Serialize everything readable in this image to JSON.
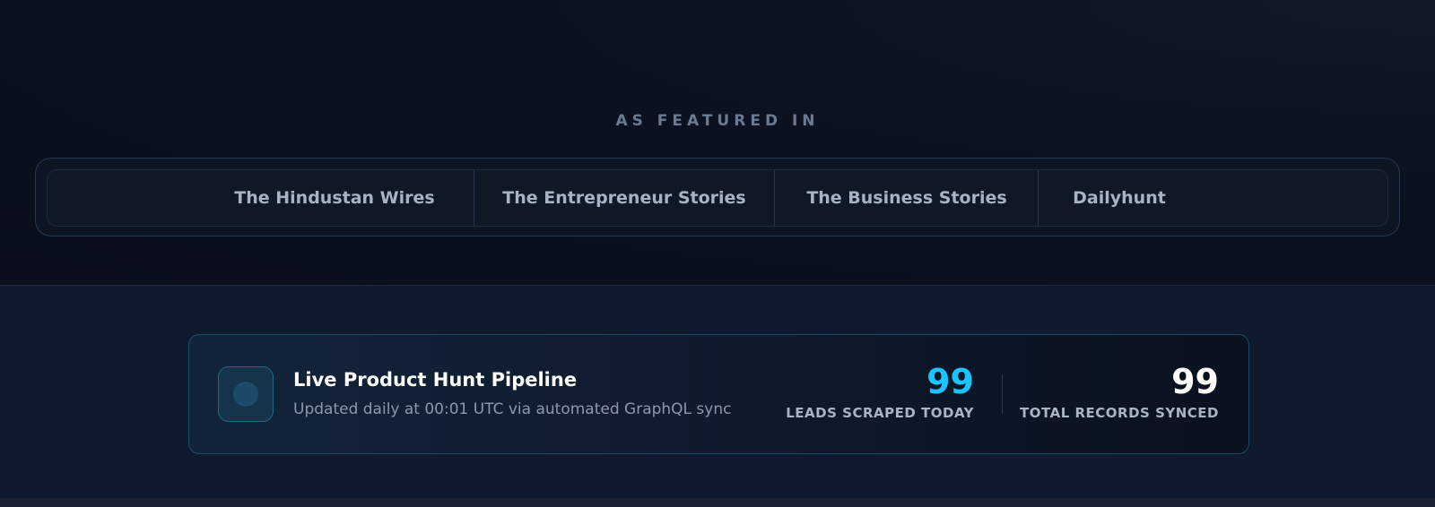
{
  "featured": {
    "heading": "AS FEATURED IN",
    "outlets": [
      "The Hindustan Wires",
      "The Entrepreneur Stories",
      "The Business Stories",
      "Dailyhunt"
    ]
  },
  "pipeline": {
    "title": "Live Product Hunt Pipeline",
    "subtitle": "Updated daily at 00:01 UTC via automated GraphQL sync",
    "stats": [
      {
        "value": "99",
        "label": "LEADS SCRAPED TODAY",
        "color": "#1cc4ff"
      },
      {
        "value": "99",
        "label": "TOTAL RECORDS SYNCED",
        "color": "#ffffff"
      }
    ],
    "status_icon": "live-status-dot-icon"
  },
  "colors": {
    "accent": "#1cc4ff",
    "background": "#0a0f1c",
    "card_border": "#1f4a63"
  }
}
